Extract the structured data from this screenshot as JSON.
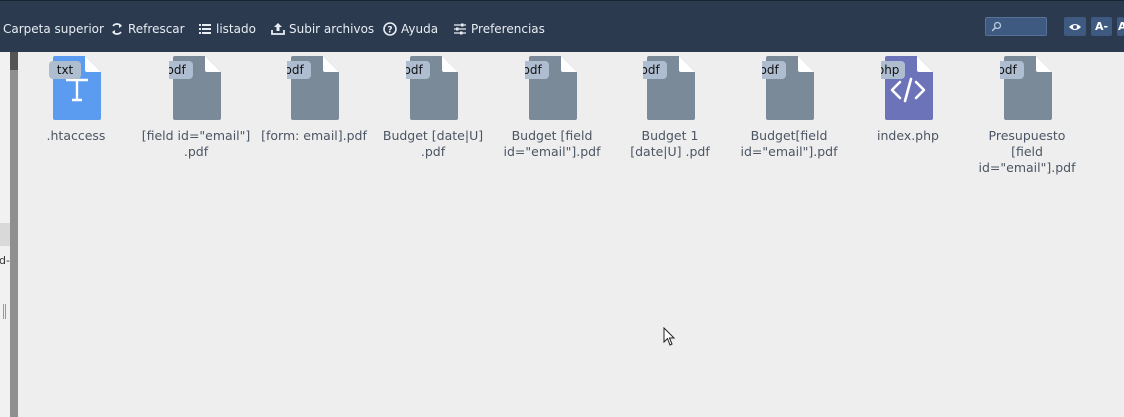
{
  "toolbar": {
    "items": [
      {
        "label": "Carpeta superior",
        "icon": "folder-up-icon"
      },
      {
        "label": "Refrescar",
        "icon": "refresh-icon"
      },
      {
        "label": "listado",
        "icon": "list-icon"
      },
      {
        "label": "Subir archivos",
        "icon": "upload-icon"
      },
      {
        "label": "Ayuda",
        "icon": "help-icon"
      },
      {
        "label": "Preferencias",
        "icon": "sliders-icon"
      }
    ],
    "search": {
      "icon": "search-icon",
      "value": ""
    },
    "view_icon": "eye-icon",
    "font_decrease_label": "A-",
    "font_increase_label": "A"
  },
  "sidebar": {
    "partial_text": "d-"
  },
  "files": [
    {
      "name": ".htaccess",
      "ext": "txt"
    },
    {
      "name": "[field id=\"email\"] .pdf",
      "ext": "pdf"
    },
    {
      "name": "[form: email].pdf",
      "ext": "pdf"
    },
    {
      "name": "Budget [date|U] .pdf",
      "ext": "pdf"
    },
    {
      "name": "Budget [field id=\"email\"].pdf",
      "ext": "pdf"
    },
    {
      "name": "Budget 1 [date|U] .pdf",
      "ext": "pdf"
    },
    {
      "name": "Budget[field id=\"email\"].pdf",
      "ext": "pdf"
    },
    {
      "name": "index.php",
      "ext": "php"
    },
    {
      "name": "Presupuesto [field id=\"email\"].pdf",
      "ext": "pdf"
    }
  ],
  "colors": {
    "toolbar_bg": "#2b3a4f",
    "pdf_file": "#7b8a99",
    "txt_file": "#5b9bf0",
    "php_file": "#6d73b8",
    "badge_bg": "#aebdd0"
  }
}
